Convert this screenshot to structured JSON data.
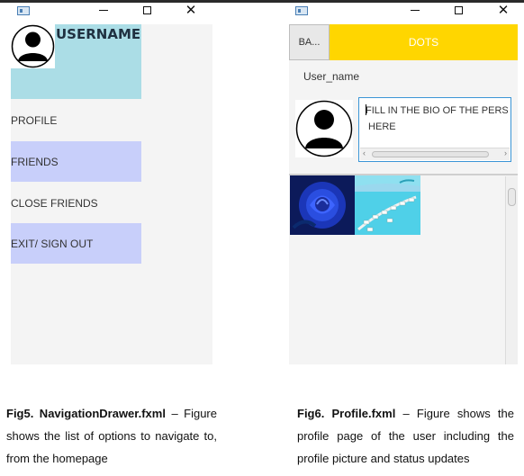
{
  "fig5": {
    "window": {
      "minimize": "Minimize",
      "maximize": "Maximize",
      "close": "Close"
    },
    "header": {
      "username": "USERNAME"
    },
    "menu": [
      {
        "label": "PROFILE",
        "highlighted": false
      },
      {
        "label": "FRIENDS",
        "highlighted": true
      },
      {
        "label": "CLOSE FRIENDS",
        "highlighted": false
      },
      {
        "label": "EXIT/ SIGN OUT",
        "highlighted": true
      }
    ],
    "caption": {
      "bold": "Fig5. NavigationDrawer.fxml",
      "text": " – Figure shows the list of options to navigate to, from the homepage"
    }
  },
  "fig6": {
    "toolbar": {
      "back_label": "BA...",
      "dots_label": "DOTS"
    },
    "user_name": "User_name",
    "bio_placeholder": "FILL IN THE BIO OF THE PERS\n HERE",
    "caption": {
      "bold": "Fig6. Profile.fxml",
      "text": " – Figure shows the profile page of the user including the profile picture and status updates"
    }
  },
  "colors": {
    "drawer_header": "#abdde6",
    "menu_highlight": "#c8cffa",
    "dots_bar": "#ffd600",
    "bio_border": "#3b95d6"
  },
  "icons": [
    "window-app-icon",
    "avatar-icon",
    "blue-rose-image",
    "tropical-resort-image"
  ]
}
